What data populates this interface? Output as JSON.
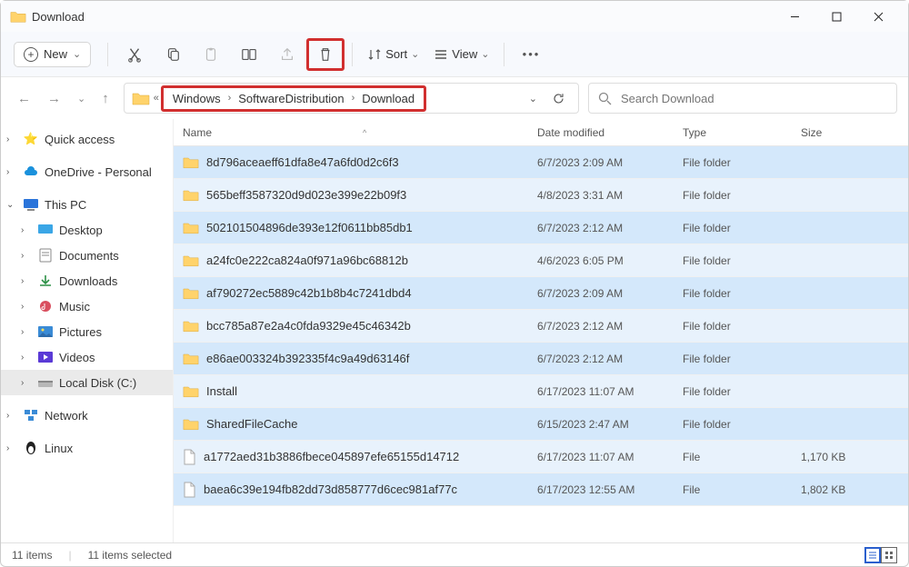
{
  "window": {
    "title": "Download"
  },
  "toolbar": {
    "new_label": "New",
    "sort_label": "Sort",
    "view_label": "View"
  },
  "breadcrumb": {
    "parts": [
      "Windows",
      "SoftwareDistribution",
      "Download"
    ]
  },
  "search": {
    "placeholder": "Search Download"
  },
  "sidebar": {
    "quick_access": "Quick access",
    "onedrive": "OneDrive - Personal",
    "this_pc": "This PC",
    "desktop": "Desktop",
    "documents": "Documents",
    "downloads": "Downloads",
    "music": "Music",
    "pictures": "Pictures",
    "videos": "Videos",
    "local_disk": "Local Disk (C:)",
    "network": "Network",
    "linux": "Linux"
  },
  "columns": {
    "name": "Name",
    "date": "Date modified",
    "type": "Type",
    "size": "Size"
  },
  "rows": [
    {
      "name": "8d796aceaeff61dfa8e47a6fd0d2c6f3",
      "date": "6/7/2023 2:09 AM",
      "type": "File folder",
      "size": "",
      "icon": "folder"
    },
    {
      "name": "565beff3587320d9d023e399e22b09f3",
      "date": "4/8/2023 3:31 AM",
      "type": "File folder",
      "size": "",
      "icon": "folder"
    },
    {
      "name": "502101504896de393e12f0611bb85db1",
      "date": "6/7/2023 2:12 AM",
      "type": "File folder",
      "size": "",
      "icon": "folder"
    },
    {
      "name": "a24fc0e222ca824a0f971a96bc68812b",
      "date": "4/6/2023 6:05 PM",
      "type": "File folder",
      "size": "",
      "icon": "folder"
    },
    {
      "name": "af790272ec5889c42b1b8b4c7241dbd4",
      "date": "6/7/2023 2:09 AM",
      "type": "File folder",
      "size": "",
      "icon": "folder"
    },
    {
      "name": "bcc785a87e2a4c0fda9329e45c46342b",
      "date": "6/7/2023 2:12 AM",
      "type": "File folder",
      "size": "",
      "icon": "folder"
    },
    {
      "name": "e86ae003324b392335f4c9a49d63146f",
      "date": "6/7/2023 2:12 AM",
      "type": "File folder",
      "size": "",
      "icon": "folder"
    },
    {
      "name": "Install",
      "date": "6/17/2023 11:07 AM",
      "type": "File folder",
      "size": "",
      "icon": "folder"
    },
    {
      "name": "SharedFileCache",
      "date": "6/15/2023 2:47 AM",
      "type": "File folder",
      "size": "",
      "icon": "folder"
    },
    {
      "name": "a1772aed31b3886fbece045897efe65155d14712",
      "date": "6/17/2023 11:07 AM",
      "type": "File",
      "size": "1,170 KB",
      "icon": "file"
    },
    {
      "name": "baea6c39e194fb82dd73d858777d6cec981af77c",
      "date": "6/17/2023 12:55 AM",
      "type": "File",
      "size": "1,802 KB",
      "icon": "file"
    }
  ],
  "status": {
    "items": "11 items",
    "selected": "11 items selected"
  }
}
